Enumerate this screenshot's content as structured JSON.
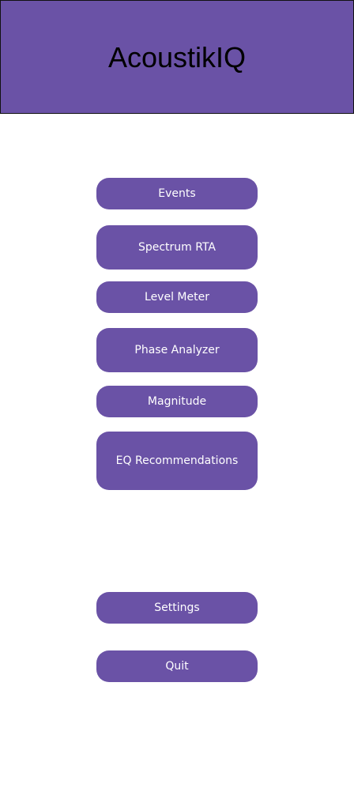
{
  "header": {
    "title": "AcoustikIQ"
  },
  "menu": {
    "events": "Events",
    "spectrum_rta": "Spectrum RTA",
    "level_meter": "Level Meter",
    "phase_analyzer": "Phase Analyzer",
    "magnitude": "Magnitude",
    "eq_recommendations": "EQ Recommendations",
    "settings": "Settings",
    "quit": "Quit"
  },
  "colors": {
    "header_bg": "#6a52a6",
    "button_bg": "#6a52a6",
    "button_text": "#ffffff",
    "title_text": "#000000",
    "page_bg": "#ffffff"
  }
}
